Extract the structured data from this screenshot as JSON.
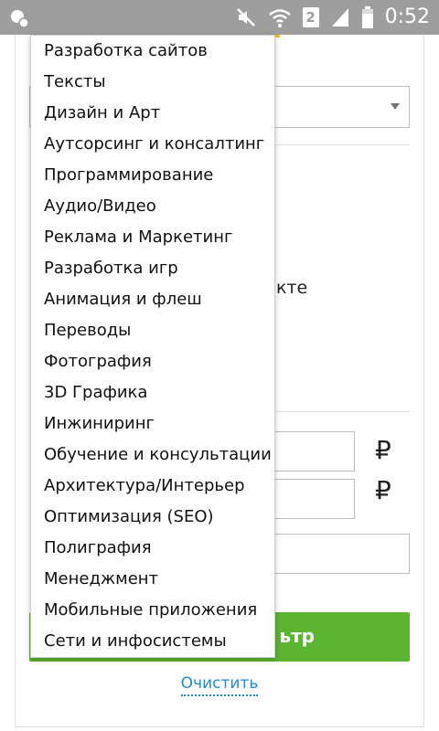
{
  "status_bar": {
    "time": "0:52",
    "sim_slot": "2",
    "left_icon": "notification-app-icon",
    "icons": [
      "mute-icon",
      "wifi-icon",
      "sim-icon",
      "signal-icon",
      "battery-icon"
    ],
    "background": "#9e9e9e"
  },
  "dropdown": {
    "items": [
      "Разработка сайтов",
      "Тексты",
      "Дизайн и Арт",
      "Аутсорсинг и консалтинг",
      "Программирование",
      "Аудио/Видео",
      "Реклама и Маркетинг",
      "Разработка игр",
      "Анимация и флеш",
      "Переводы",
      "Фотография",
      "3D Графика",
      "Инжиниринг",
      "Обучение и консультации",
      "Архитектура/Интерьер",
      "Оптимизация (SEO)",
      "Полиграфия",
      "Менеджмент",
      "Мобильные приложения",
      "Сети и инфосистемы"
    ]
  },
  "background": {
    "partial_text": "кте",
    "currency_symbol_1": "₽",
    "currency_symbol_2": "₽",
    "filter_button_partial": "ьтр",
    "clear_link": "Очистить",
    "accent_green": "#5cb531",
    "link_blue": "#1e88e5"
  }
}
